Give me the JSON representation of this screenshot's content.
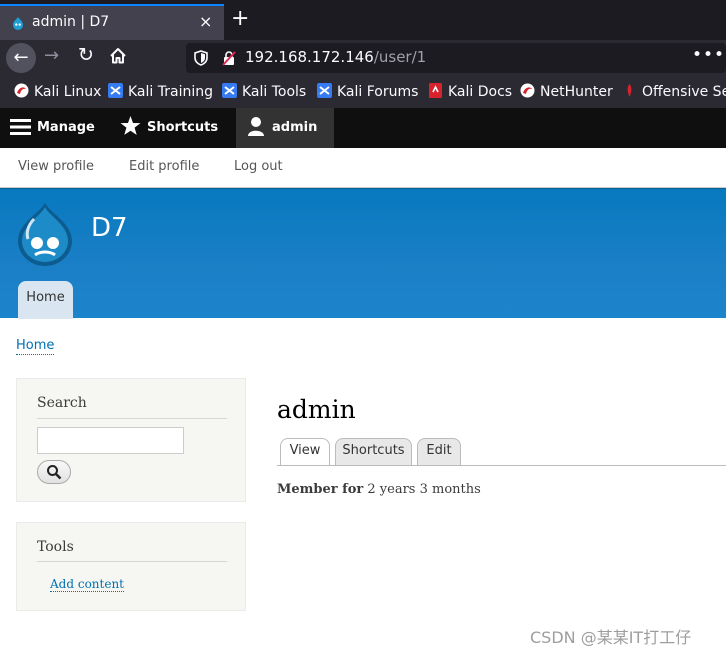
{
  "browser": {
    "tab_title": "admin | D7",
    "tab_close": "×",
    "new_tab": "+",
    "url_host": "192.168.172.146",
    "url_path": "/user/1",
    "url_more": "•••",
    "url_pocket": "⚐",
    "bookmarks": [
      {
        "label": "Kali Linux",
        "icon": "kali-dragon-icon"
      },
      {
        "label": "Kali Training",
        "icon": "kali-training-icon"
      },
      {
        "label": "Kali Tools",
        "icon": "kali-tools-icon"
      },
      {
        "label": "Kali Forums",
        "icon": "kali-forums-icon"
      },
      {
        "label": "Kali Docs",
        "icon": "kali-docs-icon"
      },
      {
        "label": "NetHunter",
        "icon": "nethunter-icon"
      },
      {
        "label": "Offensive Sec",
        "icon": "offsec-icon"
      }
    ]
  },
  "toolbar": {
    "manage": "Manage",
    "shortcuts": "Shortcuts",
    "user": "admin"
  },
  "tray": {
    "view_profile": "View profile",
    "edit_profile": "Edit profile",
    "log_out": "Log out"
  },
  "header": {
    "site_name": "D7",
    "home_tab": "Home"
  },
  "breadcrumb": "Home",
  "sidebar": {
    "search_title": "Search",
    "search_value": "",
    "tools_title": "Tools",
    "tools_link": "Add content"
  },
  "main": {
    "title": "admin",
    "tabs": [
      "View",
      "Shortcuts",
      "Edit"
    ],
    "member_label": "Member for",
    "member_value": "2 years 3 months"
  },
  "watermark": "CSDN @某某IT打工仔",
  "colors": {
    "accent": "#0a84ff",
    "drupal_blue": "#0779bf",
    "link": "#0071b3"
  }
}
